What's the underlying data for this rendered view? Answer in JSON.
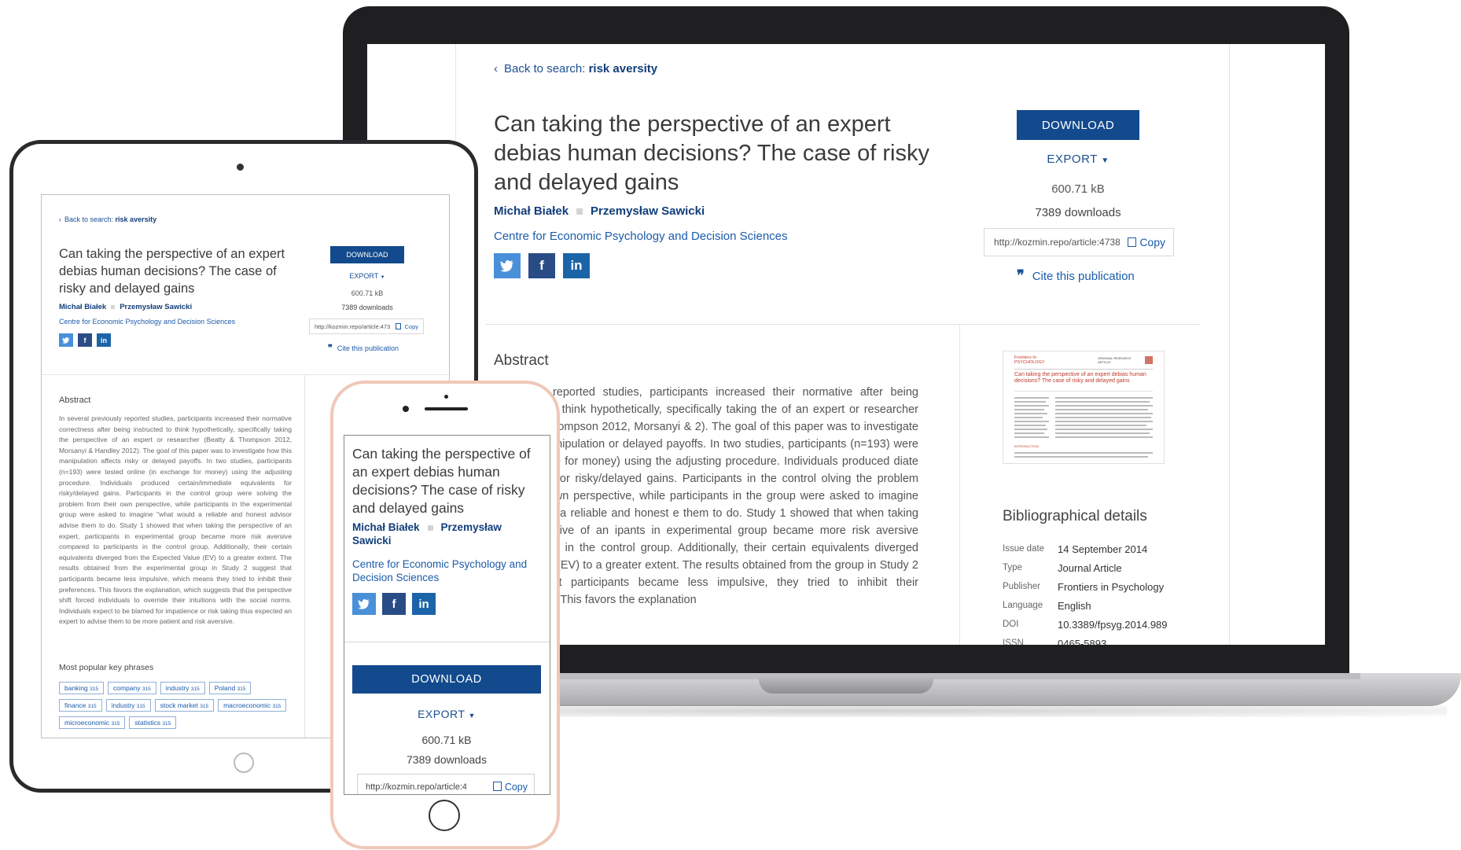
{
  "article": {
    "back_prefix": "Back to search:",
    "back_query": "risk aversity",
    "title": "Can taking the perspective of an expert debias human decisions? The case of risky and delayed gains",
    "author1": "Michał Białek",
    "author2": "Przemysław Sawicki",
    "institution": "Centre for Economic Psychology and Decision Sciences",
    "download_label": "DOWNLOAD",
    "export_label": "EXPORT",
    "file_size": "600.71 kB",
    "downloads": "7389 downloads",
    "url": "http://kozmin.repo/article:4738",
    "copy_label": "Copy",
    "cite_label": "Cite this publication",
    "social": {
      "twitter": "twitter-icon",
      "facebook": "facebook-icon",
      "linkedin": "linkedin-icon"
    }
  },
  "laptop": {
    "abstract_heading": "Abstract",
    "abstract_visible": "previously reported studies, participants increased their normative after being instructed to think hypothetically, specifically taking the of an expert or researcher (Beatty & Thompson 2012, Morsanyi & 2). The goal of this paper was to investigate how this manipulation or delayed payoffs. In two studies, participants (n=193) were tested hange for money) using the adjusting procedure. Individuals produced diate equivalents for risky/delayed gains. Participants in the control olving the problem from their own perspective, while participants in the group were asked to imagine \"what would a reliable and honest e them to do. Study 1 showed that when taking the perspective of an ipants in experimental group became more risk aversive compared to in the control group. Additionally, their certain equivalents diverged ected Value (EV) to a greater extent. The results obtained from the group in Study 2 suggest that participants became less impulsive, they tried to inhibit their preferences. This favors the explanation",
    "bib_heading": "Bibliographical details",
    "bib": [
      {
        "k": "Issue date",
        "v": "14 September 2014"
      },
      {
        "k": "Type",
        "v": "Journal Article"
      },
      {
        "k": "Publisher",
        "v": "Frontiers in Psychology"
      },
      {
        "k": "Language",
        "v": "English"
      },
      {
        "k": "DOI",
        "v": "10.3389/fpsyg.2014.989"
      },
      {
        "k": "ISSN",
        "v": "0465-5893"
      }
    ],
    "thumb": {
      "journal": "Frontiers In PSYCHOLOGY",
      "tag": "ORIGINAL RESEARCH ARTICLE",
      "title": "Can taking the perspective of an expert debias human decisions? The case of risky and delayed gains",
      "section": "INTRODUCTION"
    }
  },
  "tablet": {
    "abstract_heading": "Abstract",
    "abstract": "In several previously reported studies, participants increased their normative correctness after being instructed to think hypothetically, specifically taking the perspective of an expert or researcher (Beatty & Thompson 2012, Morsanyi & Handley 2012). The goal of this paper was to investigate how this manipulation affects risky or delayed payoffs. In two studies, participants (n=193) were tested online (in exchange for money) using the adjusting procedure. Individuals produced certain/immediate equivalents for risky/delayed gains. Participants in the control group were solving the problem from their own perspective, while participants in the experimental group were asked to imagine \"what would a reliable and honest advisor advise them to do. Study 1 showed that when taking the perspective of an expert, participants in experimental group became more risk aversive compared to participants in the control group. Additionally, their certain equivalents diverged from the Expected Value (EV) to a greater extent. The results obtained from the experimental group in Study 2 suggest that participants became less impulsive, which means they tried to inhibit their preferences. This favors the explanation, which suggests that the perspective shift forced individuals to override their intuitions with the social norms. Individuals expect to be blamed for impatience or risk taking thus expected an expert to advise them to be more patient and risk aversive.",
    "key_phrases_heading": "Most popular key phrases",
    "key_phrases": [
      {
        "label": "banking",
        "count": "315"
      },
      {
        "label": "company",
        "count": "315"
      },
      {
        "label": "industry",
        "count": "315"
      },
      {
        "label": "Poland",
        "count": "315"
      },
      {
        "label": "finance",
        "count": "315"
      },
      {
        "label": "industry",
        "count": "315"
      },
      {
        "label": "stock market",
        "count": "315"
      },
      {
        "label": "macroeconomic",
        "count": "315"
      },
      {
        "label": "microeconomic",
        "count": "315"
      },
      {
        "label": "statistics",
        "count": "315"
      }
    ]
  },
  "colors": {
    "accent": "#124a8d",
    "link": "#1b5bab",
    "twitter": "#4a90d9",
    "facebook": "#2a4c86",
    "linkedin": "#1c64a8"
  }
}
